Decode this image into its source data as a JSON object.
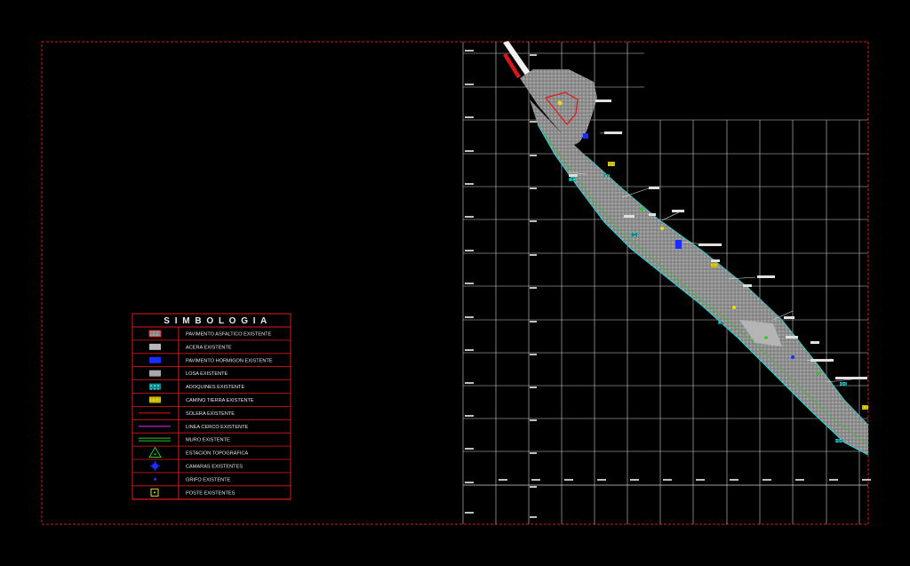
{
  "legend": {
    "title": "S I M B O L O G I A",
    "items": [
      {
        "symbol": "pavement-asphalt",
        "label": "PAVIMENTO ASFALTICO EXISTENTE"
      },
      {
        "symbol": "sidewalk",
        "label": "ACERA EXISTENTE"
      },
      {
        "symbol": "pavement-concrete",
        "label": "PAVIMENTO HORMIGON EXISTENTE"
      },
      {
        "symbol": "slab",
        "label": "LOSA EXISTENTE"
      },
      {
        "symbol": "cobblestone",
        "label": "ADOQUINES EXISTENTE"
      },
      {
        "symbol": "dirt-road",
        "label": "CAMINO TIERRA EXISTENTE"
      },
      {
        "symbol": "curb-line",
        "label": "SOLERA EXISTENTE"
      },
      {
        "symbol": "fence-line",
        "label": "LINEA CERCO EXISTENTE"
      },
      {
        "symbol": "wall-line",
        "label": "MURO EXISTENTE"
      },
      {
        "symbol": "topo-station",
        "label": "ESTACION TOPOGRAFICA"
      },
      {
        "symbol": "chamber",
        "label": "CAMARAS EXISTENTES"
      },
      {
        "symbol": "hydrant",
        "label": "GRIFO EXISTENTE"
      },
      {
        "symbol": "pole",
        "label": "POSTE EXISTENTES"
      }
    ]
  },
  "colors": {
    "border": "#e01818",
    "grid": "#d8d8d8",
    "road": "#9a9a9a",
    "cyan": "#19d9d9",
    "green": "#28c828",
    "blue": "#1a2cff",
    "yellow": "#e6dc1a",
    "magenta": "#c020c0",
    "red": "#e01818"
  }
}
